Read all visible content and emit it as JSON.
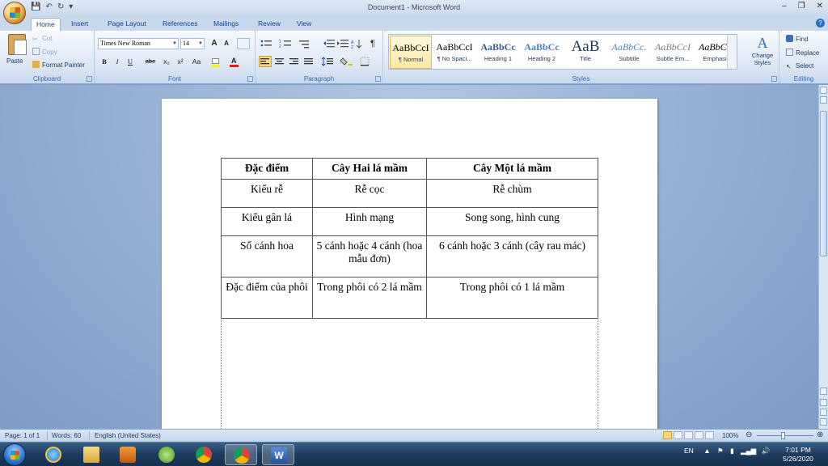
{
  "window": {
    "title": "Document1 - Microsoft Word",
    "minimize": "–",
    "restore": "❐",
    "close": "✕"
  },
  "tabs": [
    "Home",
    "Insert",
    "Page Layout",
    "References",
    "Mailings",
    "Review",
    "View"
  ],
  "ribbon": {
    "clipboard": {
      "label": "Clipboard",
      "paste": "Paste",
      "cut": "Cut",
      "copy": "Copy",
      "format_painter": "Format Painter"
    },
    "font": {
      "label": "Font",
      "family": "Times New Roman",
      "size": "14",
      "bold": "B",
      "italic": "I",
      "underline": "U",
      "strike": "abe",
      "subscript": "x₂",
      "superscript": "x²",
      "change_case": "Aa",
      "grow": "A",
      "shrink": "A"
    },
    "paragraph": {
      "label": "Paragraph",
      "pilcrow": "¶"
    },
    "styles": {
      "label": "Styles",
      "items": [
        {
          "sample": "AaBbCcI",
          "name": "¶ Normal"
        },
        {
          "sample": "AaBbCcI",
          "name": "¶ No Spaci..."
        },
        {
          "sample": "AaBbCc",
          "name": "Heading 1"
        },
        {
          "sample": "AaBbCc",
          "name": "Heading 2"
        },
        {
          "sample": "AaB",
          "name": "Title"
        },
        {
          "sample": "AaBbCc.",
          "name": "Subtitle"
        },
        {
          "sample": "AaBbCcI",
          "name": "Subtle Em..."
        },
        {
          "sample": "AaBbCcI",
          "name": "Emphasis"
        }
      ],
      "change_styles": "Change Styles"
    },
    "editing": {
      "label": "Editing",
      "find": "Find",
      "replace": "Replace",
      "select": "Select"
    }
  },
  "document": {
    "table": {
      "headers": [
        "Đặc điểm",
        "Cây Hai lá mầm",
        "Cây Một lá mầm"
      ],
      "rows": [
        [
          "Kiểu rễ",
          "Rễ cọc",
          "Rễ chùm"
        ],
        [
          "Kiểu gân lá",
          "Hình mạng",
          "Song song, hình cung"
        ],
        [
          "Số cánh hoa",
          "5 cánh hoặc 4 cánh (hoa mẫu đơn)",
          "6 cánh hoặc 3 cánh (cây rau mác)"
        ],
        [
          "Đặc điểm của phôi",
          "Trong phôi có 2 lá mầm",
          "Trong phôi có 1 lá mầm"
        ]
      ]
    }
  },
  "status": {
    "page": "Page: 1 of 1",
    "words": "Words: 60",
    "language": "English (United States)",
    "zoom": "100%"
  },
  "taskbar": {
    "language": "EN",
    "time": "7:01 PM",
    "date": "5/26/2020"
  }
}
